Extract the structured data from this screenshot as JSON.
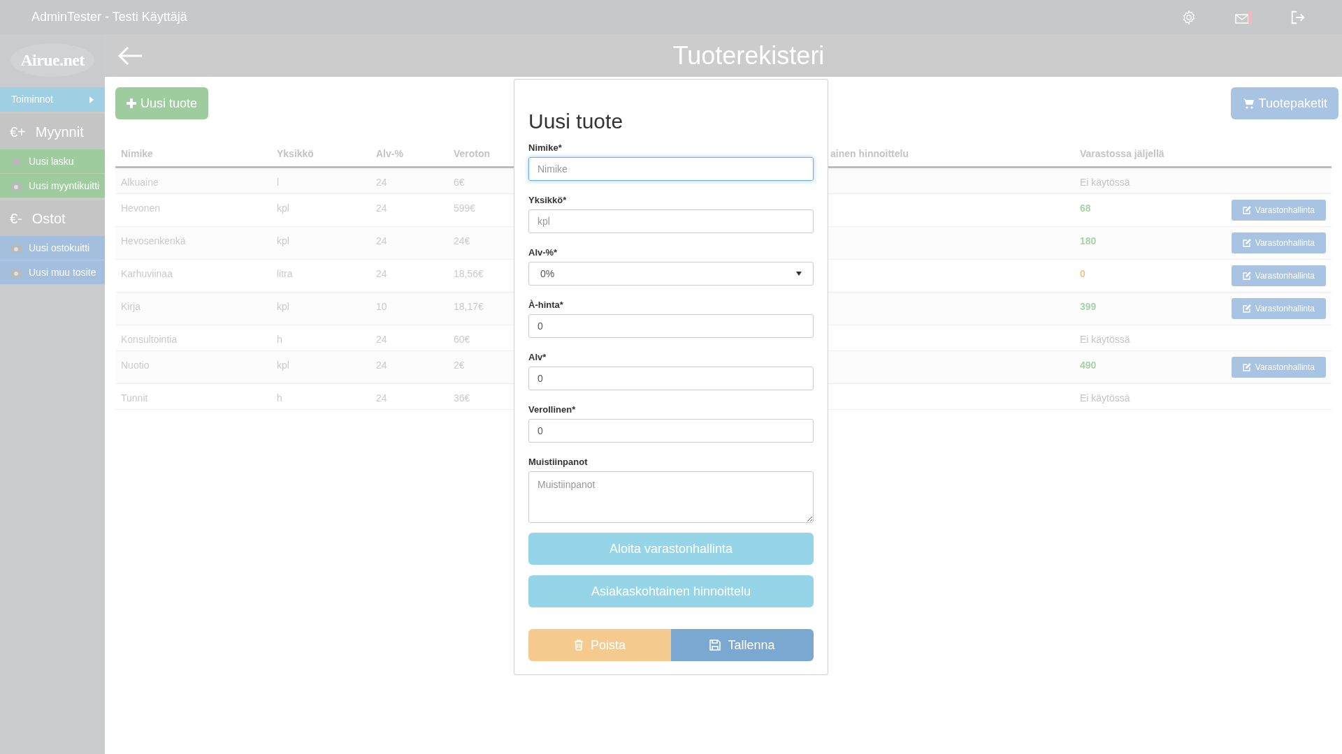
{
  "top_bar": {
    "user": "AdminTester - Testi Käyttäjä",
    "mail_alert": true
  },
  "sidebar": {
    "logo": "Airue.net",
    "menu": {
      "label": "Toiminnot"
    },
    "sections": [
      {
        "symbol": "€+",
        "title": "Myynnit",
        "kind": "sales",
        "items": [
          {
            "label": "Uusi lasku",
            "kind": "invoice"
          },
          {
            "label": "Uusi myyntikuitti",
            "kind": "receipt"
          }
        ]
      },
      {
        "symbol": "€-",
        "title": "Ostot",
        "kind": "purchases",
        "items": [
          {
            "label": "Uusi ostokuitti",
            "kind": "receipt"
          },
          {
            "label": "Uusi muu tosite",
            "kind": "receipt"
          }
        ]
      }
    ]
  },
  "header": {
    "title": "Tuoterekisteri"
  },
  "toolbar": {
    "new_button": "Uusi tuote",
    "packages_button": "Tuotepaketit"
  },
  "table": {
    "columns": [
      "Nimike",
      "Yksikkö",
      "Alv-%",
      "Veroton",
      "ainen hinnoittelu",
      "Varastossa jäljellä"
    ],
    "rows": [
      {
        "name": "Alkuaine",
        "unit": "l",
        "vat": "24",
        "price": "6€",
        "stock": "Ei käytössä",
        "kind": "untracked"
      },
      {
        "name": "Hevonen",
        "unit": "kpl",
        "vat": "24",
        "price": "599€",
        "stock": "68",
        "kind": "stocked",
        "action": "Varastonhallinta"
      },
      {
        "name": "Hevosenkenkä",
        "unit": "kpl",
        "vat": "24",
        "price": "24€",
        "stock": "180",
        "kind": "stocked",
        "action": "Varastonhallinta"
      },
      {
        "name": "Karhuviinaa",
        "unit": "litra",
        "vat": "24",
        "price": "18,56€",
        "stock": "0",
        "kind": "empty",
        "action": "Varastonhallinta"
      },
      {
        "name": "Kirja",
        "unit": "kpl",
        "vat": "10",
        "price": "18,17€",
        "stock": "399",
        "kind": "stocked",
        "action": "Varastonhallinta"
      },
      {
        "name": "Konsultointia",
        "unit": "h",
        "vat": "24",
        "price": "60€",
        "stock": "Ei käytössä",
        "kind": "untracked"
      },
      {
        "name": "Nuotio",
        "unit": "kpl",
        "vat": "24",
        "price": "2€",
        "stock": "490",
        "kind": "stocked",
        "action": "Varastonhallinta"
      },
      {
        "name": "Tunnit",
        "unit": "h",
        "vat": "24",
        "price": "36€",
        "stock": "Ei käytössä",
        "kind": "untracked"
      }
    ]
  },
  "dialog": {
    "title": "Uusi tuote",
    "fields": [
      {
        "kind": "text",
        "label": "Nimike*",
        "placeholder": "Nimike",
        "focused": true
      },
      {
        "kind": "text",
        "label": "Yksikkö*",
        "placeholder": "kpl",
        "focused": false
      },
      {
        "kind": "select",
        "label": "Alv-%*",
        "value": "0%",
        "focused": false
      },
      {
        "kind": "text",
        "label": "À-hinta*",
        "value": "0",
        "focused": false
      },
      {
        "kind": "text",
        "label": "Alv*",
        "value": "0",
        "focused": false
      },
      {
        "kind": "text",
        "label": "Verollinen*",
        "value": "0",
        "focused": false
      },
      {
        "kind": "textarea",
        "label": "Muistiinpanot",
        "placeholder": "Muistiinpanot",
        "focused": false
      }
    ],
    "wide_buttons": [
      "Aloita varastonhallinta",
      "Asiakaskohtainen hinnoittelu"
    ],
    "delete_button": "Poista",
    "save_button": "Tallenna"
  }
}
